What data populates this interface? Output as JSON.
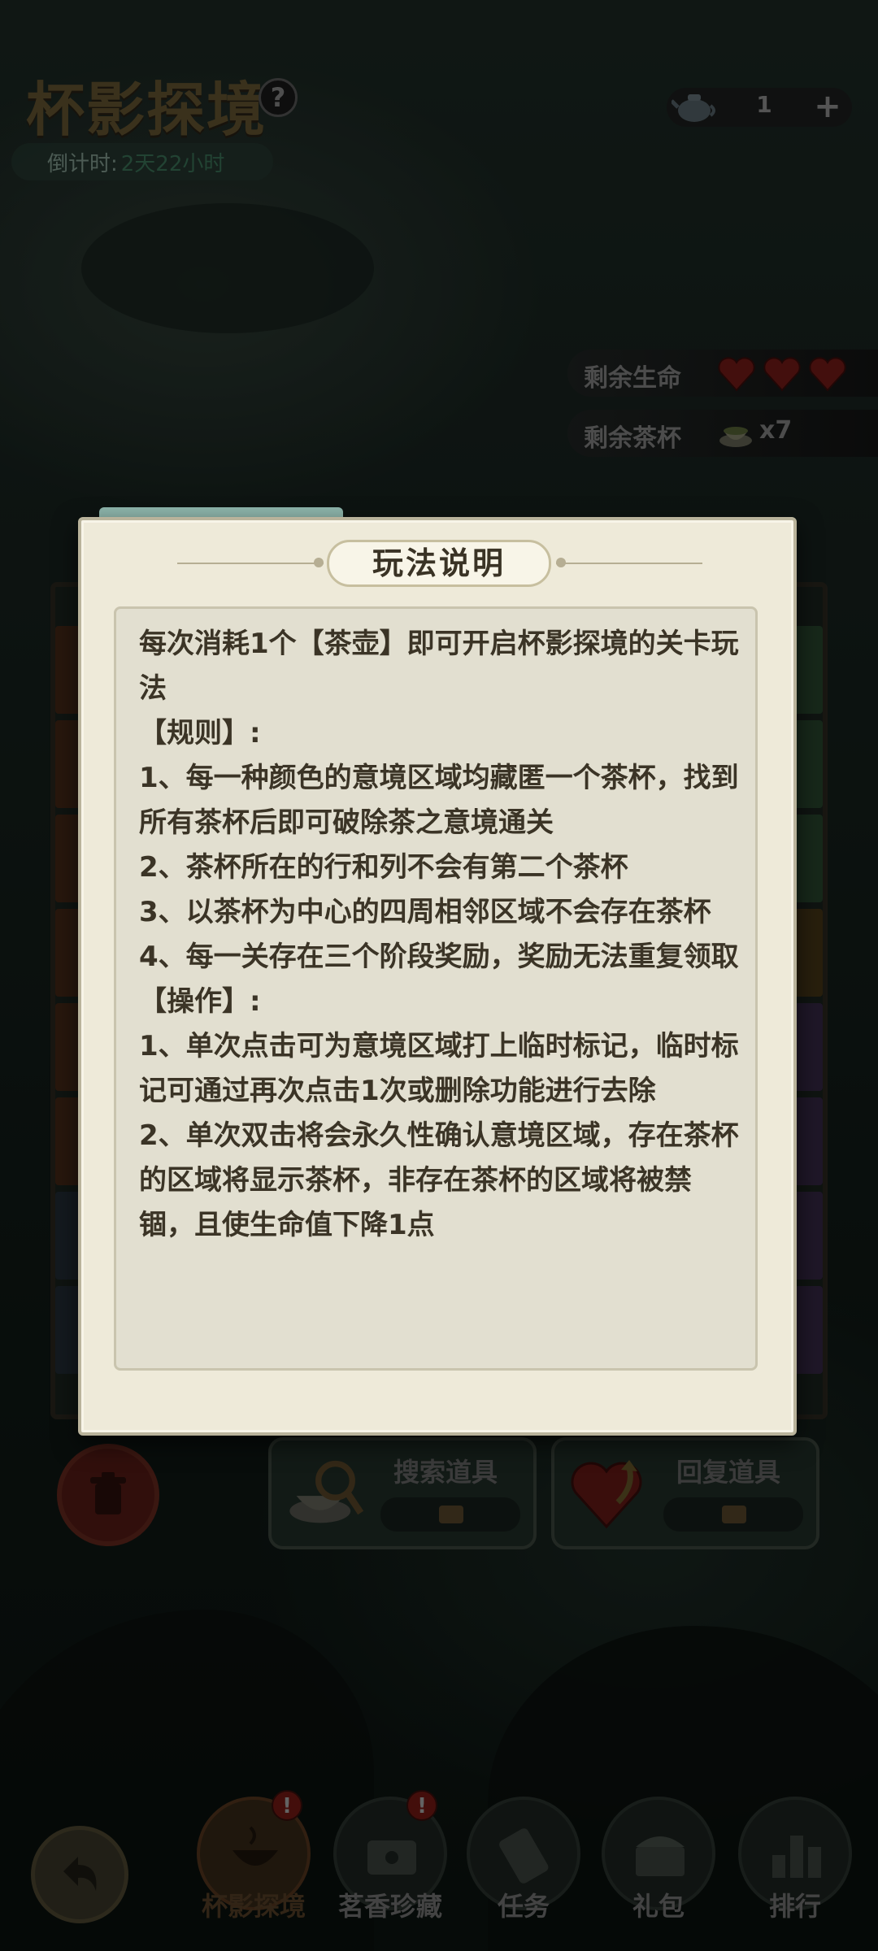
{
  "header": {
    "title": "杯影探境",
    "countdown_label": "倒计时:",
    "countdown_value": "2天22小时",
    "teapot_count": "1",
    "plus": "+"
  },
  "stats": {
    "lives_label": "剩余生命",
    "lives": 3,
    "cups_label": "剩余茶杯",
    "cups_count": "x7"
  },
  "modal": {
    "title": "玩法说明",
    "lines": [
      "每次消耗1个【茶壶】即可开启杯影探境的关卡玩法",
      "【规则】:",
      "1、每一种颜色的意境区域均藏匿一个茶杯，找到所有茶杯后即可破除茶之意境通关",
      "2、茶杯所在的行和列不会有第二个茶杯",
      "3、以茶杯为中心的四周相邻区域不会存在茶杯",
      "4、每一关存在三个阶段奖励，奖励无法重复领取",
      "【操作】:",
      "1、单次点击可为意境区域打上临时标记，临时标记可通过再次点击1次或删除功能进行去除",
      "2、单次双击将会永久性确认意境区域，存在茶杯的区域将显示茶杯，非存在茶杯的区域将被禁锢，且使生命值下降1点"
    ]
  },
  "tools": {
    "search_label": "搜索道具",
    "recover_label": "回复道具"
  },
  "nav": {
    "items": [
      {
        "label": "杯影探境",
        "badge": "!"
      },
      {
        "label": "茗香珍藏",
        "badge": "!"
      },
      {
        "label": "任务"
      },
      {
        "label": "礼包"
      },
      {
        "label": "排行"
      }
    ]
  },
  "colors": {
    "modal_bg": "#eeead9",
    "text": "#3b3426",
    "heart": "#7a1c18"
  }
}
